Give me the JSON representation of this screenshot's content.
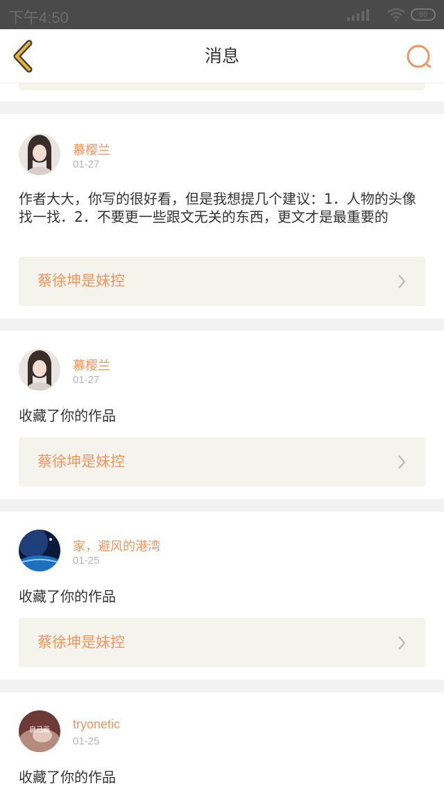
{
  "status_bar": {
    "time": "下午4:50",
    "battery": "98"
  },
  "header": {
    "title": "消息",
    "back_icon": "chevron-left-icon",
    "search_icon": "search-icon"
  },
  "colors": {
    "accent": "#f0955d",
    "back_icon": "#e8b52a",
    "card_bg": "#f4f3ec"
  },
  "messages": [
    {
      "name": "慕樱兰",
      "date": "01-27",
      "text": "作者大大，你写的很好看，但是我想提几个建议：1．人物的头像找一找．2．不要更一些跟文无关的东西，更文才是最重要的",
      "work": "蔡徐坤是妹控"
    },
    {
      "name": "慕樱兰",
      "date": "01-27",
      "text": "收藏了你的作品",
      "work": "蔡徐坤是妹控"
    },
    {
      "name": "家，避风的港湾",
      "date": "01-25",
      "text": "收藏了你的作品",
      "work": "蔡徐坤是妹控"
    },
    {
      "name": "tryonetic",
      "date": "01-25",
      "text": "收藏了你的作品",
      "avatar_caption": "自己画"
    }
  ]
}
